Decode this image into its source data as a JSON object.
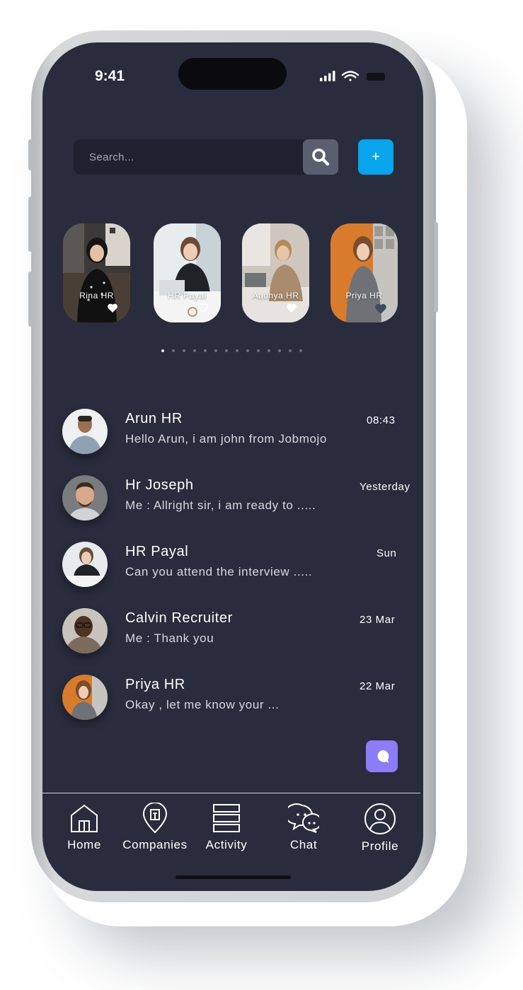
{
  "status_bar": {
    "time": "9:41"
  },
  "search": {
    "placeholder": "Search..."
  },
  "add_button": {
    "label": "+"
  },
  "stories": [
    {
      "name": "Rina HR"
    },
    {
      "name": "HR Payal"
    },
    {
      "name": "Aadhya HR"
    },
    {
      "name": "Priya HR"
    }
  ],
  "chats": [
    {
      "name": "Arun HR",
      "message": "Hello Arun, i am john from Jobmojo",
      "time": "08:43"
    },
    {
      "name": "Hr Joseph",
      "message": "Me : Allright sir, i am ready to .....",
      "time": "Yesterday"
    },
    {
      "name": "HR Payal",
      "message": "Can you attend the interview .....",
      "time": "Sun"
    },
    {
      "name": "Calvin Recruiter",
      "message": "Me : Thank you",
      "time": "23 Mar"
    },
    {
      "name": "Priya HR",
      "message": "Okay , let me know your ...",
      "time": "22 Mar"
    }
  ],
  "nav": [
    {
      "label": "Home",
      "icon": "home-icon"
    },
    {
      "label": "Companies",
      "icon": "location-pin-icon"
    },
    {
      "label": "Activity",
      "icon": "activity-list-icon"
    },
    {
      "label": "Chat",
      "icon": "chat-bubbles-icon"
    },
    {
      "label": "Profile",
      "icon": "profile-icon"
    }
  ],
  "colors": {
    "background": "#292c3d",
    "accent_blue": "#08a4ec",
    "fab_purple": "#8b7cf8"
  }
}
